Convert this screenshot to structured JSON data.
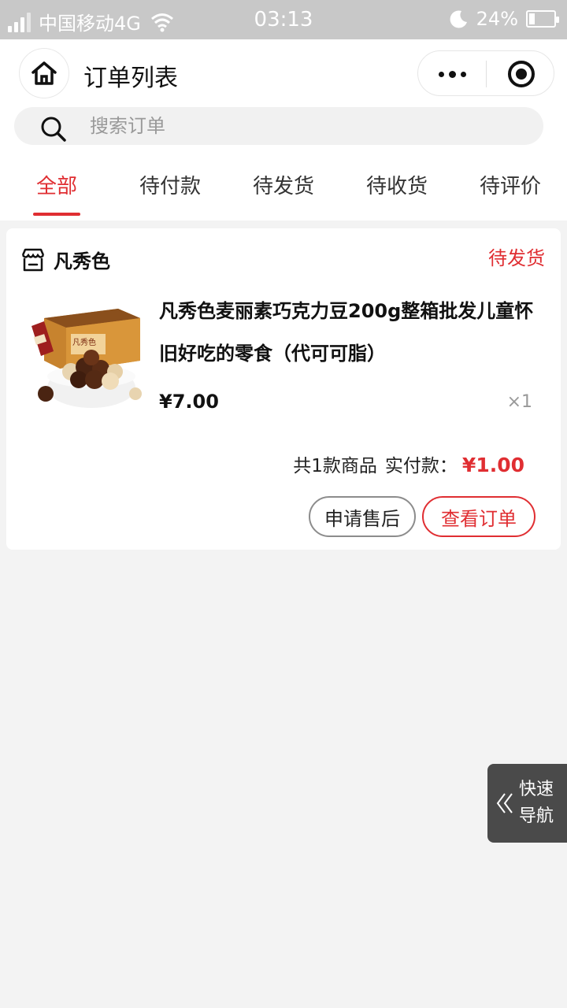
{
  "status_bar": {
    "carrier": "中国移动4G",
    "time": "03:13",
    "battery": "24%",
    "battery_level": 0.24
  },
  "nav": {
    "title": "订单列表"
  },
  "search": {
    "placeholder": "搜索订单"
  },
  "tabs": [
    {
      "label": "全部",
      "active": true
    },
    {
      "label": "待付款",
      "active": false
    },
    {
      "label": "待发货",
      "active": false
    },
    {
      "label": "待收货",
      "active": false
    },
    {
      "label": "待评价",
      "active": false
    }
  ],
  "order": {
    "shop_name": "凡秀色",
    "status": "待发货",
    "product": {
      "title": "凡秀色麦丽素巧克力豆200g整箱批发儿童怀旧好吃的零食（代可可脂）",
      "price": "¥7.00",
      "qty": "×1",
      "box_text": "凡秀色"
    },
    "summary_count": "共1款商品",
    "summary_paid_label": "实付款：",
    "summary_amount": "¥1.00",
    "btn_after_sale": "申请售后",
    "btn_view_order": "查看订单"
  },
  "quick_nav": {
    "label": "快速导航"
  },
  "colors": {
    "accent": "#e02e32",
    "status_bar_bg": "#c8c8c8",
    "quick_nav_bg": "#4a4a4a"
  }
}
